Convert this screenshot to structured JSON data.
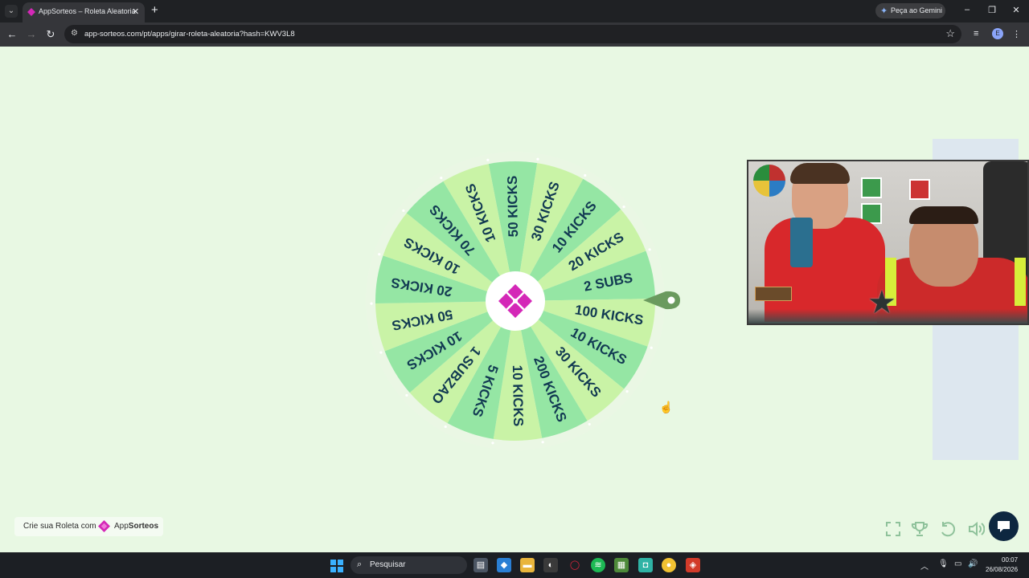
{
  "browser": {
    "tab_title": "AppSorteos – Roleta Aleatoria",
    "url": "app-sorteos.com/pt/apps/girar-roleta-aleatoria?hash=KWV3L8",
    "gemini_label": "Peça ao Gemini",
    "profile_initial": "E"
  },
  "wheel": {
    "segments": [
      "50 KICKS",
      "30 KICKS",
      "10 KICKS",
      "20 KICKS",
      "2 SUBS",
      "100 KICKS",
      "10 KICKS",
      "30 KICKS",
      "200 KICKS",
      "10 KICKS",
      "5 KICKS",
      "1 SUBZAO",
      "10 KICKS",
      "50 KICKS",
      "20 KICKS",
      "10 KICKS",
      "70 KICKS",
      "10 KICKS"
    ],
    "colors": {
      "light": "#c9f3a6",
      "dark": "#95e6a4",
      "rim": "#eaf7e4",
      "text": "#123a52",
      "center": "#d428b7",
      "pointer": "#6a9a5e"
    }
  },
  "footer": {
    "prefix": "Crie sua Roleta com",
    "brand_light": "App",
    "brand_bold": "Sorteos"
  },
  "controls": [
    "fullscreen-icon",
    "trophy-icon",
    "reset-icon",
    "volume-icon",
    "chat-icon"
  ],
  "taskbar": {
    "search_placeholder": "Pesquisar",
    "time": "00:07",
    "date": "26/08/2026"
  }
}
